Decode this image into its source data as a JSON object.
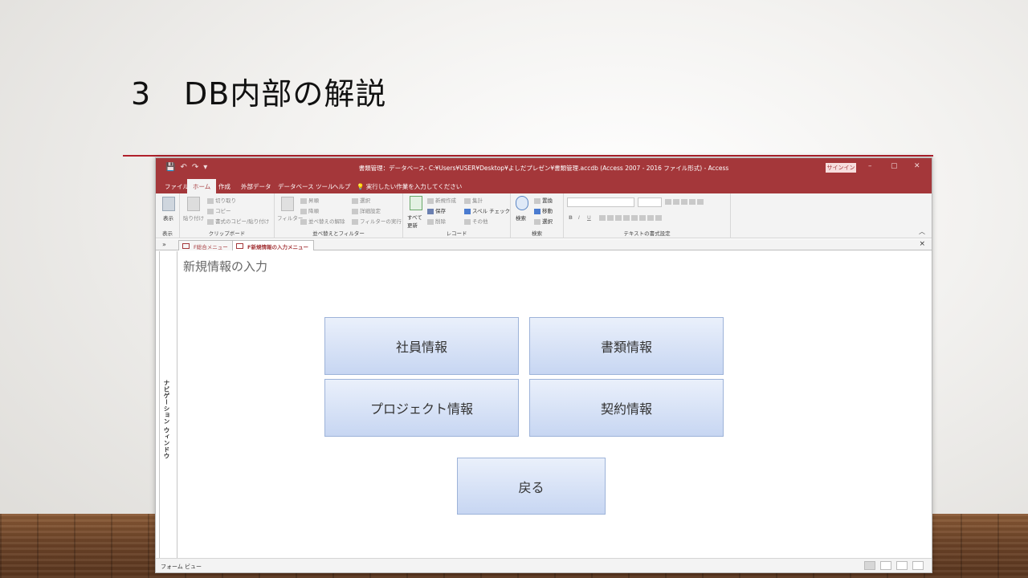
{
  "slide": {
    "title_number": "3",
    "title_text": "DB内部の解説"
  },
  "window": {
    "title": "書類管理：データベース- C:¥Users¥USER¥Desktop¥よしだプレゼン¥書類管理.accdb (Access 2007 - 2016 ファイル形式) - Access",
    "signin": "サインイン",
    "controls": [
      "–",
      "▢",
      "✕"
    ],
    "qat": [
      "💾",
      "↶",
      "↷",
      "▾"
    ]
  },
  "menu": {
    "tabs": [
      "ファイル",
      "ホーム",
      "作成",
      "外部データ",
      "データベース ツール",
      "ヘルプ"
    ],
    "active_tab": "ホーム",
    "tellme": "実行したい作業を入力してください"
  },
  "ribbon": {
    "groups": {
      "view": {
        "label": "表示",
        "button": "表示"
      },
      "clipboard": {
        "label": "クリップボード",
        "paste": "貼り付け",
        "cut": "切り取り",
        "copy": "コピー",
        "format_painter": "書式のコピー/貼り付け"
      },
      "sort_filter": {
        "label": "並べ替えとフィルター",
        "filter": "フィルター",
        "asc": "昇順",
        "desc": "降順",
        "clear_sort": "並べ替えの解除",
        "selection": "選択",
        "advanced": "詳細設定",
        "toggle_filter": "フィルターの実行"
      },
      "records": {
        "label": "レコード",
        "refresh": "すべて更新",
        "new": "新規作成",
        "save": "保存",
        "delete": "削除",
        "totals": "集計",
        "spelling": "スペル チェック",
        "more": "その他"
      },
      "find": {
        "label": "検索",
        "find": "検索",
        "replace": "置換",
        "goto": "移動",
        "select": "選択"
      },
      "text_format": {
        "label": "テキストの書式設定",
        "bold": "B",
        "italic": "I",
        "underline": "U"
      }
    }
  },
  "doc_tabs": [
    {
      "label": "F総合メニュー",
      "active": false
    },
    {
      "label": "F新規情報の入力メニュー",
      "active": true
    }
  ],
  "nav_pane": {
    "label": "ナビゲーション ウィンドウ"
  },
  "form": {
    "title": "新規情報の入力",
    "buttons": {
      "employee": "社員情報",
      "documents": "書類情報",
      "project": "プロジェクト情報",
      "contract": "契約情報",
      "back": "戻る"
    }
  },
  "status": {
    "view_name": "フォーム ビュー"
  },
  "colors": {
    "access_accent": "#a4373a",
    "title_rule": "#b0202c",
    "button_fill": "#c7d6f2"
  }
}
